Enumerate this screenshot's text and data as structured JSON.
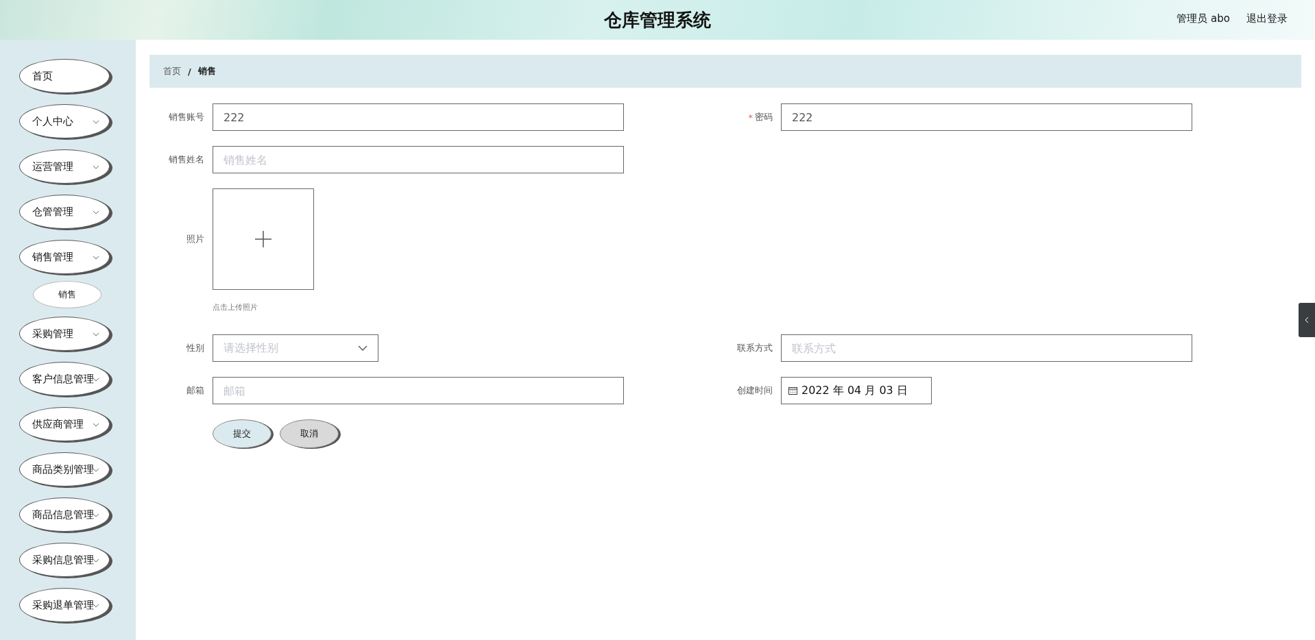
{
  "header": {
    "title": "仓库管理系统",
    "user": "管理员 abo",
    "logout": "退出登录"
  },
  "sidebar": {
    "items": [
      {
        "label": "首页",
        "kind": "link"
      },
      {
        "label": "个人中心",
        "kind": "group"
      },
      {
        "label": "运营管理",
        "kind": "group"
      },
      {
        "label": "仓管管理",
        "kind": "group"
      },
      {
        "label": "销售管理",
        "kind": "group",
        "children": [
          {
            "label": "销售"
          }
        ]
      },
      {
        "label": "采购管理",
        "kind": "group"
      },
      {
        "label": "客户信息管理",
        "kind": "group"
      },
      {
        "label": "供应商管理",
        "kind": "group"
      },
      {
        "label": "商品类别管理",
        "kind": "group"
      },
      {
        "label": "商品信息管理",
        "kind": "group"
      },
      {
        "label": "采购信息管理",
        "kind": "group"
      },
      {
        "label": "采购退单管理",
        "kind": "group"
      }
    ]
  },
  "breadcrumb": {
    "items": [
      "首页",
      "销售"
    ],
    "separator": "/"
  },
  "form": {
    "rows": [
      [
        {
          "label": "销售账号",
          "kind": "input",
          "value": "222"
        },
        {
          "label": "密码",
          "required_mark": "*",
          "kind": "input",
          "value": "222"
        }
      ],
      [
        {
          "label": "销售姓名",
          "kind": "input",
          "placeholder": "销售姓名"
        }
      ],
      [
        {
          "label": "照片",
          "kind": "upload",
          "hint": "点击上传照片"
        }
      ],
      [
        {
          "label": "性别",
          "kind": "select",
          "placeholder": "请选择性别"
        },
        {
          "label": "联系方式",
          "kind": "input",
          "placeholder": "联系方式"
        }
      ],
      [
        {
          "label": "邮箱",
          "kind": "input",
          "placeholder": "邮箱"
        },
        {
          "label": "创建时间",
          "kind": "date",
          "value": "2022 年 04 月 03 日"
        }
      ]
    ],
    "buttons": [
      {
        "label": "提交",
        "kind": "primary"
      },
      {
        "label": "取消",
        "kind": "cancel"
      }
    ]
  }
}
